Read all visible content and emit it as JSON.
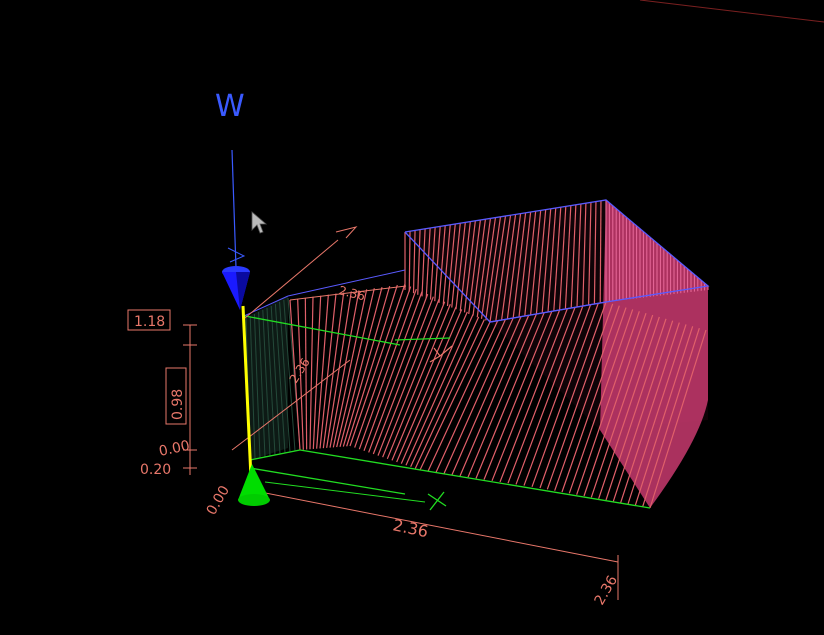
{
  "viewport": {
    "background": "#000000",
    "axes": {
      "z": "W",
      "y": "Y",
      "x": "X"
    },
    "dimensions": {
      "height_top": "1.18",
      "height_mid": "0.98",
      "height_low": "0.00",
      "height_base": "0.20",
      "origin": "0.00",
      "width_x": "2.36",
      "depth_right": "2.36",
      "top_edge": "2.36",
      "side_edge": "2.36"
    },
    "colors": {
      "dimension": "#e8776a",
      "surface_lines": "#e0606a",
      "surface_fill": "#c83a6e",
      "top_edge": "#5a5aff",
      "base_edge": "#22dd22",
      "tool_axis": "#ffff00",
      "tool_top_cone": "#1a1aff",
      "tool_bottom_cone": "#00dd00",
      "pointer": "#bbbbbb"
    },
    "icons": [
      "pointer-cursor-icon",
      "tool-top-cone-icon",
      "tool-bottom-cone-icon"
    ]
  }
}
